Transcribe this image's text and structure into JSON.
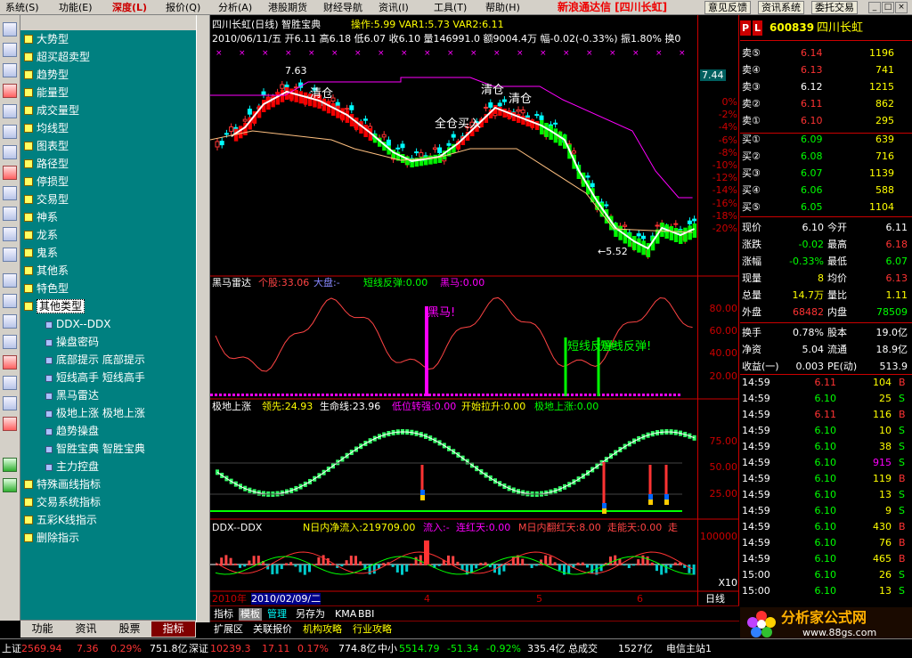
{
  "menu": {
    "items": [
      "系统(S)",
      "功能(E)",
      "深度(L)",
      "报价(Q)",
      "分析(A)",
      "港股期货",
      "财经导航",
      "资讯(I)",
      "工具(T)",
      "帮助(H)"
    ],
    "app_title": "新浪通达信 [四川长虹]",
    "buttons": [
      "意见反馈",
      "资讯系统",
      "委托交易"
    ]
  },
  "tree": {
    "items": [
      "大势型",
      "超买超卖型",
      "趋势型",
      "能量型",
      "成交量型",
      "均线型",
      "图表型",
      "路径型",
      "停损型",
      "交易型",
      "神系",
      "龙系",
      "鬼系",
      "其他系",
      "特色型",
      "其他类型"
    ],
    "sub_items": [
      "DDX--DDX",
      "操盘密码",
      "底部提示 底部提示",
      "短线高手 短线高手",
      "黑马雷达",
      "极地上涨 极地上涨",
      "趋势操盘",
      "智胜宝典 智胜宝典",
      "主力控盘"
    ],
    "more_items": [
      "特殊画线指标",
      "交易系统指标",
      "五彩K线指示",
      "删除指示"
    ],
    "tabs": [
      "功能",
      "资讯",
      "股票",
      "指标"
    ]
  },
  "chart": {
    "title": "四川长虹(日线) 智胜宝典",
    "top_line": "操作:5.99 VAR1:5.73 VAR2:6.11",
    "info": "2010/06/11/五 开6.11 高6.18 低6.07 收6.10 量146991.0 额9004.4万 幅-0.02(-0.33%) 振1.80% 换0",
    "labels": {
      "high": "7.63",
      "low": "←5.52",
      "qc1": "清仓",
      "qc2": "清仓",
      "qc3": "清仓",
      "qc4": "全仓买入"
    },
    "price_tag": "7.44",
    "ind2": {
      "name": "黑马雷达",
      "v1": "个股:33.06",
      "v2": "大盘:-",
      "v3": "短线反弹:0.00",
      "v4": "黑马:0.00",
      "ann1": "黑马!",
      "ann2": "短线反弹!",
      "ann3": "短线反弹!"
    },
    "ind3": {
      "name": "极地上涨",
      "v1": "领先:24.93",
      "v2": "生命线:23.96",
      "v3": "低位转强:0.00",
      "v4": "开始拉升:0.00",
      "v5": "极地上涨:0.00"
    },
    "ind4": {
      "name": "DDX--DDX",
      "v1": "N日内净流入:219709.00",
      "v2": "流入:-",
      "v3": "连红天:0.00",
      "v4": "M日内翻红天:8.00",
      "v5": "走能天:0.00",
      "v6": "走"
    },
    "dates": [
      "2010年",
      "2010/02/09/二",
      "4",
      "5",
      "6",
      "日线"
    ],
    "scale1": [
      "0%",
      "-2%",
      "-4%",
      "-6%",
      "-8%",
      "-10%",
      "-12%",
      "-14%",
      "-16%",
      "-18%",
      "-20%"
    ],
    "scale2": [
      "80.00",
      "60.00",
      "40.00",
      "20.00"
    ],
    "scale3": [
      "75.00",
      "50.00",
      "25.00"
    ],
    "scale4": [
      "100000",
      "X10"
    ]
  },
  "bottom_tabs": [
    "指标",
    "模板",
    "管理",
    "另存为",
    "KMA",
    "BBI"
  ],
  "bottom_tabs2": [
    "扩展区",
    "关联报价",
    "机构攻略",
    "行业攻略"
  ],
  "quote": {
    "code": "600839",
    "name": "四川长虹",
    "sells": [
      [
        "卖⑤",
        "6.14",
        "1196"
      ],
      [
        "卖④",
        "6.13",
        "741"
      ],
      [
        "卖③",
        "6.12",
        "1215"
      ],
      [
        "卖②",
        "6.11",
        "862"
      ],
      [
        "卖①",
        "6.10",
        "295"
      ]
    ],
    "buys": [
      [
        "买①",
        "6.09",
        "639"
      ],
      [
        "买②",
        "6.08",
        "716"
      ],
      [
        "买③",
        "6.07",
        "1139"
      ],
      [
        "买④",
        "6.06",
        "588"
      ],
      [
        "买⑤",
        "6.05",
        "1104"
      ]
    ],
    "stats": [
      [
        "现价",
        "6.10",
        "今开",
        "6.11"
      ],
      [
        "涨跌",
        "-0.02",
        "最高",
        "6.18"
      ],
      [
        "涨幅",
        "-0.33%",
        "最低",
        "6.07"
      ],
      [
        "现量",
        "8",
        "均价",
        "6.13"
      ],
      [
        "总量",
        "14.7万",
        "量比",
        "1.11"
      ],
      [
        "外盘",
        "68482",
        "内盘",
        "78509"
      ],
      [
        "换手",
        "0.78%",
        "股本",
        "19.0亿"
      ],
      [
        "净资",
        "5.04",
        "流通",
        "18.9亿"
      ],
      [
        "收益(一)",
        "0.003",
        "PE(动)",
        "513.9"
      ]
    ],
    "ticks": [
      [
        "14:59",
        "6.11",
        "104",
        "B"
      ],
      [
        "14:59",
        "6.10",
        "25",
        "S"
      ],
      [
        "14:59",
        "6.11",
        "116",
        "B"
      ],
      [
        "14:59",
        "6.10",
        "10",
        "S"
      ],
      [
        "14:59",
        "6.10",
        "38",
        "S"
      ],
      [
        "14:59",
        "6.10",
        "915",
        "S"
      ],
      [
        "14:59",
        "6.10",
        "119",
        "B"
      ],
      [
        "14:59",
        "6.10",
        "13",
        "S"
      ],
      [
        "14:59",
        "6.10",
        "9",
        "S"
      ],
      [
        "14:59",
        "6.10",
        "430",
        "B"
      ],
      [
        "14:59",
        "6.10",
        "76",
        "B"
      ],
      [
        "14:59",
        "6.10",
        "465",
        "B"
      ],
      [
        "15:00",
        "6.10",
        "26",
        "S"
      ],
      [
        "15:00",
        "6.10",
        "13",
        "S"
      ]
    ]
  },
  "logo": {
    "text": "分析家公式网",
    "url": "www.88gs.com"
  },
  "status": {
    "sh_label": "上证",
    "sh": "2569.94",
    "sh_chg": "7.36",
    "sh_pct": "0.29%",
    "sh_amt": "751.8亿",
    "sz_label": "深证",
    "sz": "10239.3",
    "sz_chg": "17.11",
    "sz_pct": "0.17%",
    "sz_amt": "774.8亿",
    "zx_label": "中小",
    "zx": "5514.79",
    "zx_chg": "-51.34",
    "zx_pct": "-0.92%",
    "zx_amt": "335.4亿",
    "total_label": "总成交",
    "total": "1527亿",
    "server": "电信主站1"
  }
}
